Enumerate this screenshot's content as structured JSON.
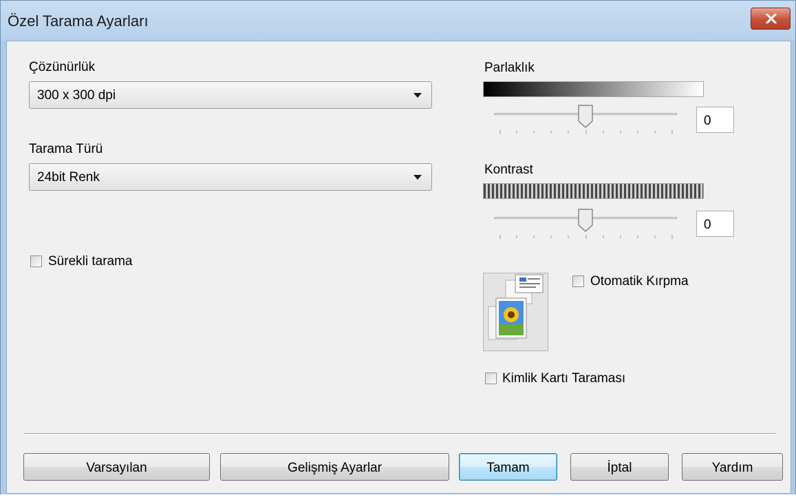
{
  "window": {
    "title": "Özel Tarama Ayarları"
  },
  "resolution": {
    "label": "Çözünürlük",
    "value": "300 x 300 dpi"
  },
  "scan_type": {
    "label": "Tarama Türü",
    "value": "24bit Renk"
  },
  "continuous_scan": {
    "label": "Sürekli tarama",
    "checked": false
  },
  "brightness": {
    "label": "Parlaklık",
    "value": "0",
    "slider_fraction": 0.5
  },
  "contrast": {
    "label": "Kontrast",
    "value": "0",
    "slider_fraction": 0.5
  },
  "auto_crop": {
    "label": "Otomatik Kırpma",
    "checked": false
  },
  "id_card_scan": {
    "label": "Kimlik Kartı Taraması",
    "checked": false
  },
  "buttons": {
    "default": "Varsayılan",
    "advanced": "Gelişmiş Ayarlar",
    "ok": "Tamam",
    "cancel": "İptal",
    "help": "Yardım"
  },
  "icons": {
    "close": "close-icon",
    "crop_preview": "auto-crop-preview-icon"
  },
  "colors": {
    "titlebar": "#b7d0ea",
    "close_button": "#c8503a",
    "default_button": "#bee6fd"
  }
}
